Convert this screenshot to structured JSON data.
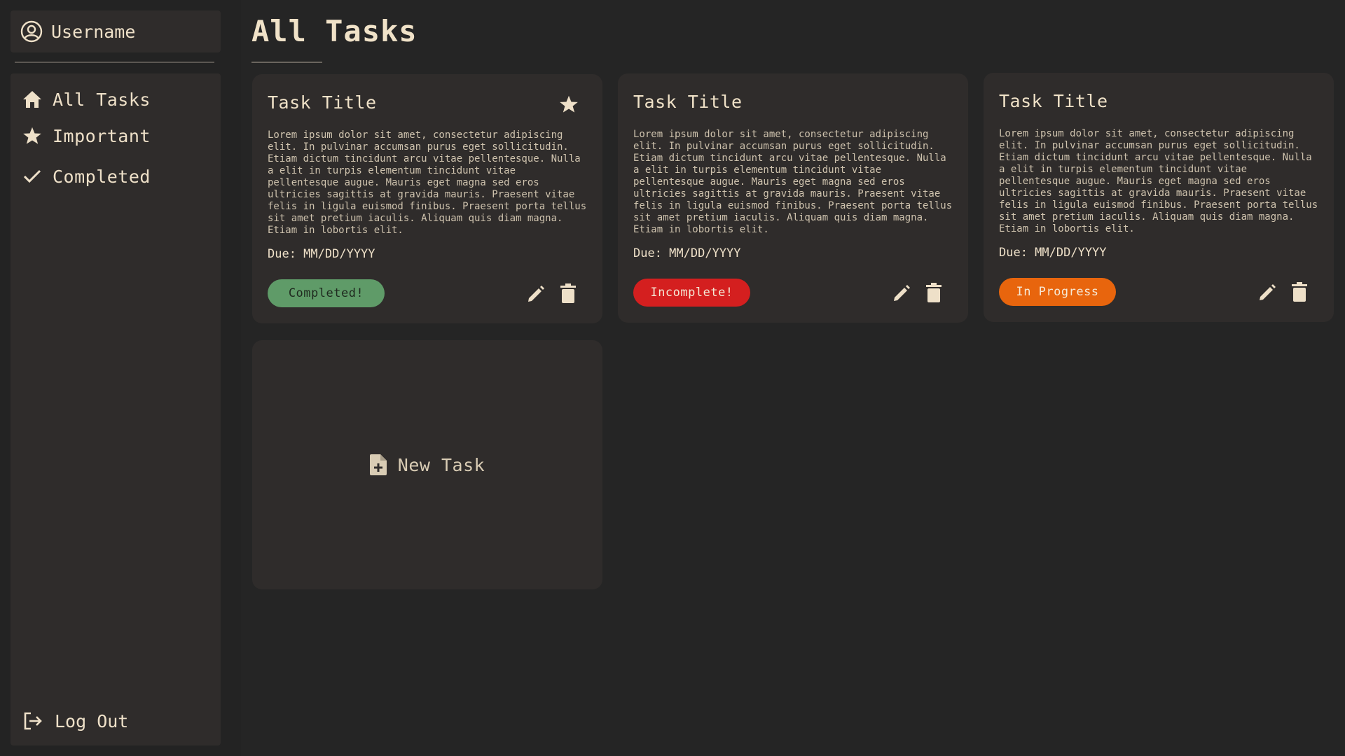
{
  "sidebar": {
    "username": "Username",
    "nav": [
      {
        "label": "All Tasks",
        "icon": "home-icon"
      },
      {
        "label": "Important",
        "icon": "star-icon"
      },
      {
        "label": "Completed",
        "icon": "check-icon"
      }
    ],
    "logout_label": "Log Out"
  },
  "main": {
    "title": "All Tasks",
    "tasks": [
      {
        "title": "Task Title",
        "description": "Lorem ipsum dolor sit amet, consectetur adipiscing elit. In pulvinar accumsan purus eget sollicitudin. Etiam dictum tincidunt arcu vitae pellentesque. Nulla a elit in turpis elementum tincidunt vitae pellentesque augue. Mauris eget magna sed eros ultricies sagittis at gravida mauris. Praesent vitae felis in ligula euismod finibus. Praesent porta tellus sit amet pretium iaculis. Aliquam quis diam magna. Etiam in lobortis elit.",
        "due": "Due: MM/DD/YYYY",
        "status": "Completed!",
        "important": true
      },
      {
        "title": "Task Title",
        "description": "Lorem ipsum dolor sit amet, consectetur adipiscing elit. In pulvinar accumsan purus eget sollicitudin. Etiam dictum tincidunt arcu vitae pellentesque. Nulla a elit in turpis elementum tincidunt vitae pellentesque augue. Mauris eget magna sed eros ultricies sagittis at gravida mauris. Praesent vitae felis in ligula euismod finibus. Praesent porta tellus sit amet pretium iaculis. Aliquam quis diam magna. Etiam in lobortis elit.",
        "due": "Due: MM/DD/YYYY",
        "status": "Incomplete!",
        "important": false
      },
      {
        "title": "Task Title",
        "description": "Lorem ipsum dolor sit amet, consectetur adipiscing elit. In pulvinar accumsan purus eget sollicitudin. Etiam dictum tincidunt arcu vitae pellentesque. Nulla a elit in turpis elementum tincidunt vitae pellentesque augue. Mauris eget magna sed eros ultricies sagittis at gravida mauris. Praesent vitae felis in ligula euismod finibus. Praesent porta tellus sit amet pretium iaculis. Aliquam quis diam magna. Etiam in lobortis elit.",
        "due": "Due: MM/DD/YYYY",
        "status": "In Progress",
        "important": false
      }
    ],
    "new_task_label": "New Task"
  },
  "colors": {
    "background": "#252525",
    "panel": "#2f2c2b",
    "text": "#eee0c8",
    "status_completed": "#5f9b68",
    "status_incomplete": "#d41f1f",
    "status_in_progress": "#e8650d"
  }
}
